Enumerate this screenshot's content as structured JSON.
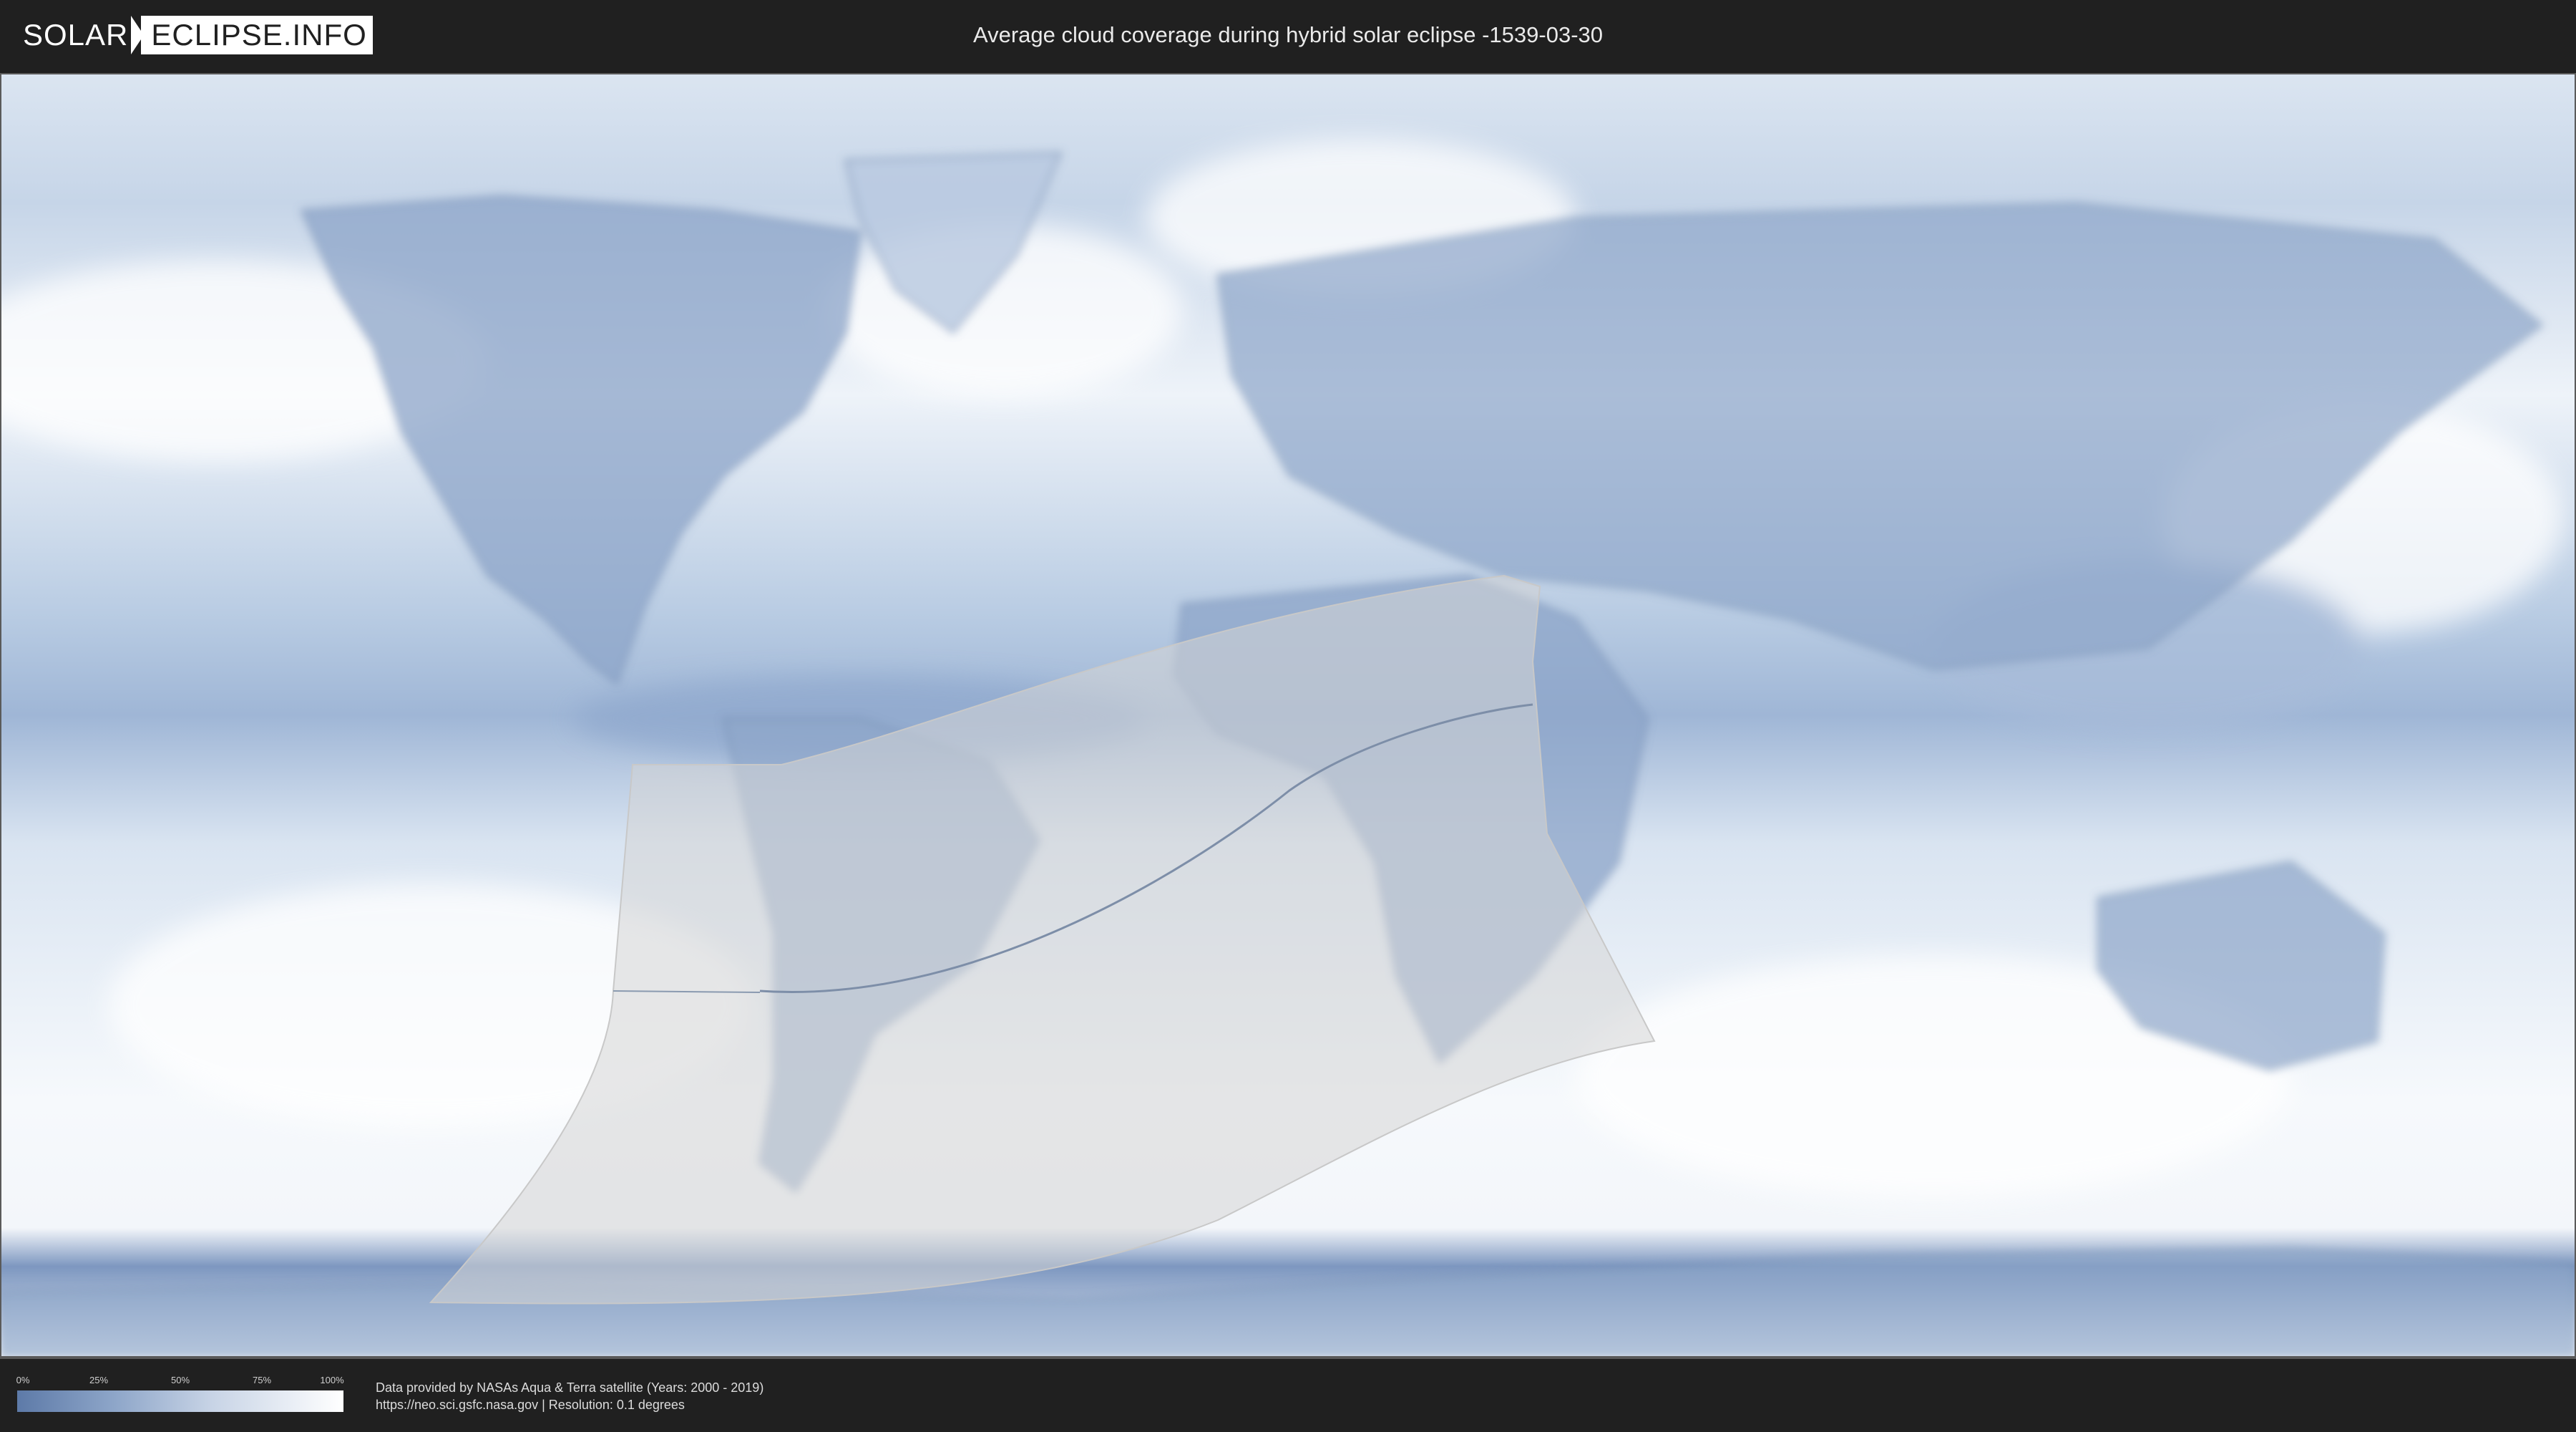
{
  "header": {
    "logo_word1": "SOLAR",
    "logo_word2": "ECLIPSE.INFO",
    "title": "Average cloud coverage during hybrid solar eclipse -1539-03-30"
  },
  "legend": {
    "ticks": [
      "0%",
      "25%",
      "50%",
      "75%",
      "100%"
    ],
    "scale_colors": [
      "#5d7aa8",
      "#8ea6c9",
      "#c8d4e6",
      "#ffffff"
    ]
  },
  "credits": {
    "line1": "Data provided by NASAs Aqua & Terra satellite (Years: 2000 - 2019)",
    "line2": "https://neo.sci.gsfc.nasa.gov | Resolution: 0.1 degrees"
  },
  "map": {
    "description_colors": {
      "clear": "#4f6f9f",
      "cloudy": "#ffffff",
      "eclipse_zone": "#d8d8d8"
    }
  }
}
